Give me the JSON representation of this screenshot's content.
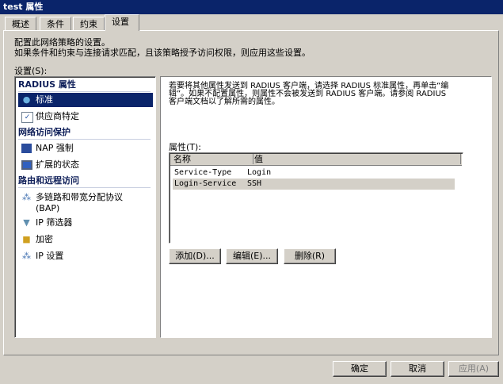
{
  "window": {
    "title": "test 属性"
  },
  "tabs": [
    {
      "label": "概述"
    },
    {
      "label": "条件"
    },
    {
      "label": "约束"
    },
    {
      "label": "设置"
    }
  ],
  "intro": {
    "line1": "配置此网络策略的设置。",
    "line2": "如果条件和约束与连接请求匹配，且该策略授予访问权限，则应用这些设置。"
  },
  "settings_label": "设置(S):",
  "sidebar": {
    "groups": [
      {
        "title": "RADIUS 属性",
        "items": [
          {
            "label": "标准",
            "icon": "globe-icon",
            "selected": true
          },
          {
            "label": "供应商特定",
            "icon": "checklist-icon"
          }
        ]
      },
      {
        "title": "网络访问保护",
        "items": [
          {
            "label": "NAP 强制",
            "icon": "nap-computer-icon"
          },
          {
            "label": "扩展的状态",
            "icon": "monitor-icon"
          }
        ]
      },
      {
        "title": "路由和远程访问",
        "items": [
          {
            "label": "多链路和带宽分配协议",
            "label2": "(BAP)",
            "icon": "network-icon"
          },
          {
            "label": "IP 筛选器",
            "icon": "filter-icon"
          },
          {
            "label": "加密",
            "icon": "lock-icon"
          },
          {
            "label": "IP 设置",
            "icon": "network-icon"
          }
        ]
      }
    ]
  },
  "detail": {
    "description": [
      "若要将其他属性发送到 RADIUS 客户端，请选择 RADIUS 标准属性，再单击“编",
      "辑”。如果不配置属性，则属性不会被发送到 RADIUS 客户端。请参阅 RADIUS",
      "客户端文档以了解所需的属性。"
    ],
    "attributes_label": "属性(T):",
    "columns": [
      "名称",
      "值"
    ],
    "rows": [
      [
        "Service-Type",
        "Login"
      ],
      [
        "Login-Service",
        "SSH"
      ]
    ],
    "buttons": {
      "add": "添加(D)...",
      "edit": "编辑(E)...",
      "remove": "删除(R)"
    }
  },
  "footer": {
    "ok": "确定",
    "cancel": "取消",
    "apply": "应用(A)"
  }
}
